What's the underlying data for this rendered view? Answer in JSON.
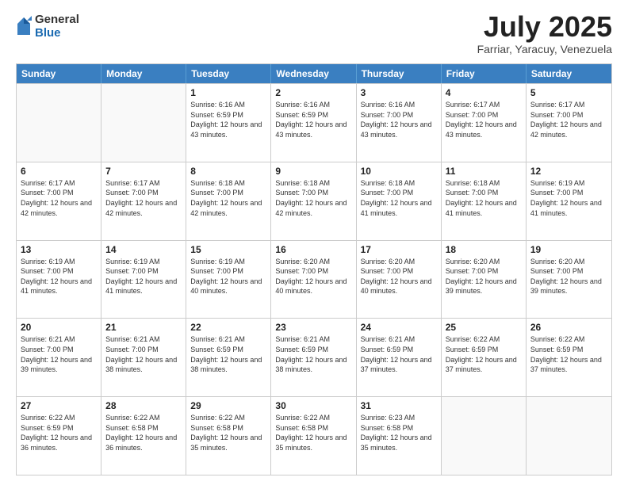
{
  "logo": {
    "general": "General",
    "blue": "Blue"
  },
  "header": {
    "month": "July 2025",
    "location": "Farriar, Yaracuy, Venezuela"
  },
  "days_of_week": [
    "Sunday",
    "Monday",
    "Tuesday",
    "Wednesday",
    "Thursday",
    "Friday",
    "Saturday"
  ],
  "weeks": [
    [
      {
        "day": "",
        "sunrise": "",
        "sunset": "",
        "daylight": ""
      },
      {
        "day": "",
        "sunrise": "",
        "sunset": "",
        "daylight": ""
      },
      {
        "day": "1",
        "sunrise": "Sunrise: 6:16 AM",
        "sunset": "Sunset: 6:59 PM",
        "daylight": "Daylight: 12 hours and 43 minutes."
      },
      {
        "day": "2",
        "sunrise": "Sunrise: 6:16 AM",
        "sunset": "Sunset: 6:59 PM",
        "daylight": "Daylight: 12 hours and 43 minutes."
      },
      {
        "day": "3",
        "sunrise": "Sunrise: 6:16 AM",
        "sunset": "Sunset: 7:00 PM",
        "daylight": "Daylight: 12 hours and 43 minutes."
      },
      {
        "day": "4",
        "sunrise": "Sunrise: 6:17 AM",
        "sunset": "Sunset: 7:00 PM",
        "daylight": "Daylight: 12 hours and 43 minutes."
      },
      {
        "day": "5",
        "sunrise": "Sunrise: 6:17 AM",
        "sunset": "Sunset: 7:00 PM",
        "daylight": "Daylight: 12 hours and 42 minutes."
      }
    ],
    [
      {
        "day": "6",
        "sunrise": "Sunrise: 6:17 AM",
        "sunset": "Sunset: 7:00 PM",
        "daylight": "Daylight: 12 hours and 42 minutes."
      },
      {
        "day": "7",
        "sunrise": "Sunrise: 6:17 AM",
        "sunset": "Sunset: 7:00 PM",
        "daylight": "Daylight: 12 hours and 42 minutes."
      },
      {
        "day": "8",
        "sunrise": "Sunrise: 6:18 AM",
        "sunset": "Sunset: 7:00 PM",
        "daylight": "Daylight: 12 hours and 42 minutes."
      },
      {
        "day": "9",
        "sunrise": "Sunrise: 6:18 AM",
        "sunset": "Sunset: 7:00 PM",
        "daylight": "Daylight: 12 hours and 42 minutes."
      },
      {
        "day": "10",
        "sunrise": "Sunrise: 6:18 AM",
        "sunset": "Sunset: 7:00 PM",
        "daylight": "Daylight: 12 hours and 41 minutes."
      },
      {
        "day": "11",
        "sunrise": "Sunrise: 6:18 AM",
        "sunset": "Sunset: 7:00 PM",
        "daylight": "Daylight: 12 hours and 41 minutes."
      },
      {
        "day": "12",
        "sunrise": "Sunrise: 6:19 AM",
        "sunset": "Sunset: 7:00 PM",
        "daylight": "Daylight: 12 hours and 41 minutes."
      }
    ],
    [
      {
        "day": "13",
        "sunrise": "Sunrise: 6:19 AM",
        "sunset": "Sunset: 7:00 PM",
        "daylight": "Daylight: 12 hours and 41 minutes."
      },
      {
        "day": "14",
        "sunrise": "Sunrise: 6:19 AM",
        "sunset": "Sunset: 7:00 PM",
        "daylight": "Daylight: 12 hours and 41 minutes."
      },
      {
        "day": "15",
        "sunrise": "Sunrise: 6:19 AM",
        "sunset": "Sunset: 7:00 PM",
        "daylight": "Daylight: 12 hours and 40 minutes."
      },
      {
        "day": "16",
        "sunrise": "Sunrise: 6:20 AM",
        "sunset": "Sunset: 7:00 PM",
        "daylight": "Daylight: 12 hours and 40 minutes."
      },
      {
        "day": "17",
        "sunrise": "Sunrise: 6:20 AM",
        "sunset": "Sunset: 7:00 PM",
        "daylight": "Daylight: 12 hours and 40 minutes."
      },
      {
        "day": "18",
        "sunrise": "Sunrise: 6:20 AM",
        "sunset": "Sunset: 7:00 PM",
        "daylight": "Daylight: 12 hours and 39 minutes."
      },
      {
        "day": "19",
        "sunrise": "Sunrise: 6:20 AM",
        "sunset": "Sunset: 7:00 PM",
        "daylight": "Daylight: 12 hours and 39 minutes."
      }
    ],
    [
      {
        "day": "20",
        "sunrise": "Sunrise: 6:21 AM",
        "sunset": "Sunset: 7:00 PM",
        "daylight": "Daylight: 12 hours and 39 minutes."
      },
      {
        "day": "21",
        "sunrise": "Sunrise: 6:21 AM",
        "sunset": "Sunset: 7:00 PM",
        "daylight": "Daylight: 12 hours and 38 minutes."
      },
      {
        "day": "22",
        "sunrise": "Sunrise: 6:21 AM",
        "sunset": "Sunset: 6:59 PM",
        "daylight": "Daylight: 12 hours and 38 minutes."
      },
      {
        "day": "23",
        "sunrise": "Sunrise: 6:21 AM",
        "sunset": "Sunset: 6:59 PM",
        "daylight": "Daylight: 12 hours and 38 minutes."
      },
      {
        "day": "24",
        "sunrise": "Sunrise: 6:21 AM",
        "sunset": "Sunset: 6:59 PM",
        "daylight": "Daylight: 12 hours and 37 minutes."
      },
      {
        "day": "25",
        "sunrise": "Sunrise: 6:22 AM",
        "sunset": "Sunset: 6:59 PM",
        "daylight": "Daylight: 12 hours and 37 minutes."
      },
      {
        "day": "26",
        "sunrise": "Sunrise: 6:22 AM",
        "sunset": "Sunset: 6:59 PM",
        "daylight": "Daylight: 12 hours and 37 minutes."
      }
    ],
    [
      {
        "day": "27",
        "sunrise": "Sunrise: 6:22 AM",
        "sunset": "Sunset: 6:59 PM",
        "daylight": "Daylight: 12 hours and 36 minutes."
      },
      {
        "day": "28",
        "sunrise": "Sunrise: 6:22 AM",
        "sunset": "Sunset: 6:58 PM",
        "daylight": "Daylight: 12 hours and 36 minutes."
      },
      {
        "day": "29",
        "sunrise": "Sunrise: 6:22 AM",
        "sunset": "Sunset: 6:58 PM",
        "daylight": "Daylight: 12 hours and 35 minutes."
      },
      {
        "day": "30",
        "sunrise": "Sunrise: 6:22 AM",
        "sunset": "Sunset: 6:58 PM",
        "daylight": "Daylight: 12 hours and 35 minutes."
      },
      {
        "day": "31",
        "sunrise": "Sunrise: 6:23 AM",
        "sunset": "Sunset: 6:58 PM",
        "daylight": "Daylight: 12 hours and 35 minutes."
      },
      {
        "day": "",
        "sunrise": "",
        "sunset": "",
        "daylight": ""
      },
      {
        "day": "",
        "sunrise": "",
        "sunset": "",
        "daylight": ""
      }
    ]
  ]
}
